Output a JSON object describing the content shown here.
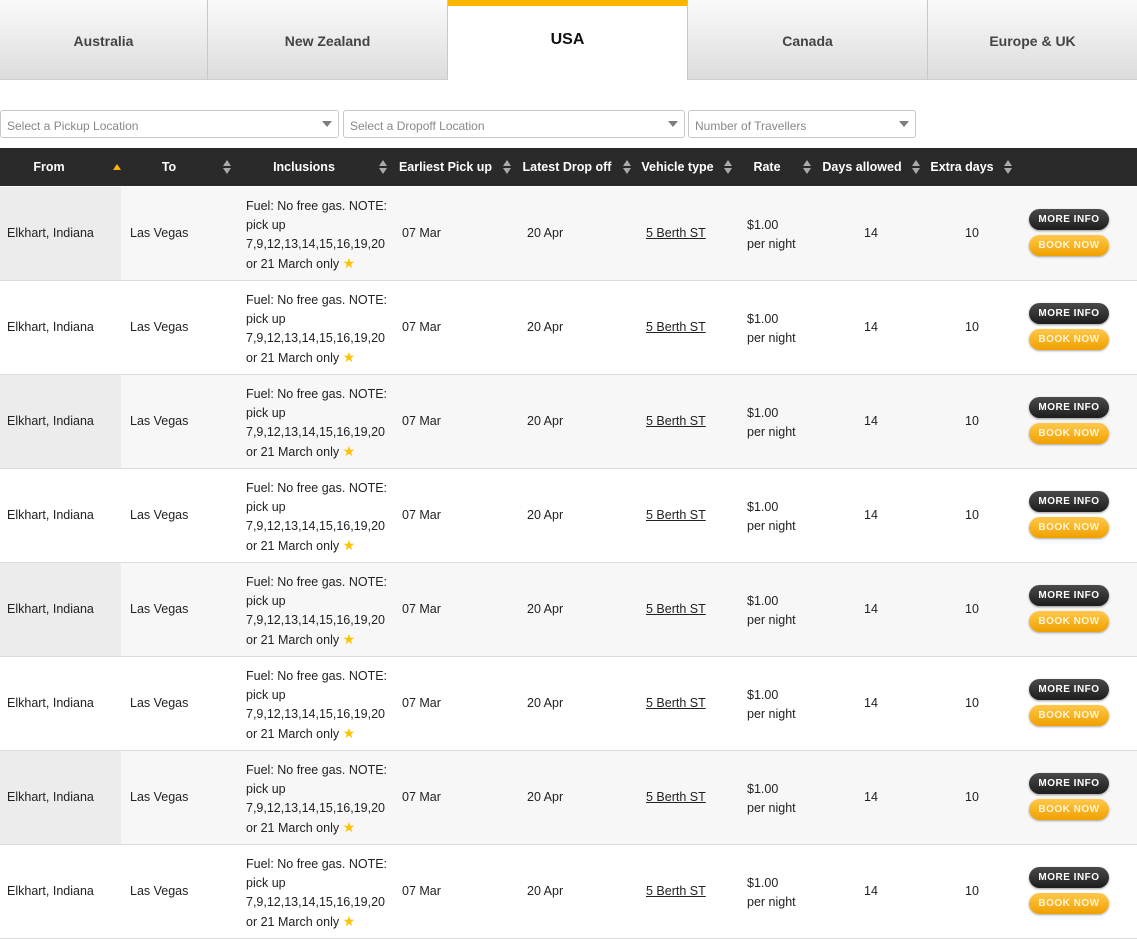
{
  "tabs": [
    {
      "label": "Australia",
      "active": false
    },
    {
      "label": "New Zealand",
      "active": false
    },
    {
      "label": "USA",
      "active": true
    },
    {
      "label": "Canada",
      "active": false
    },
    {
      "label": "Europe & UK",
      "active": false
    }
  ],
  "filters": {
    "pickup": "Select a Pickup Location",
    "dropoff": "Select a Dropoff Location",
    "travellers": "Number of Travellers"
  },
  "columns": {
    "from": "From",
    "to": "To",
    "inclusions": "Inclusions",
    "earliest": "Earliest Pick up",
    "latest": "Latest Drop off",
    "vehicle": "Vehicle type",
    "rate": "Rate",
    "days": "Days allowed",
    "extra": "Extra days"
  },
  "rows": [
    {
      "from": "Elkhart, Indiana",
      "to": "Las Vegas",
      "inclusions": "Fuel: No free gas. NOTE: pick up 7,9,12,13,14,15,16,19,20 or 21 March only",
      "earliest": "07 Mar",
      "latest": "20 Apr",
      "vehicle": "5 Berth ST",
      "rate": "$1.00",
      "rate_unit": "per night",
      "days": "14",
      "extra": "10",
      "more": "MORE INFO",
      "book": "BOOK NOW"
    },
    {
      "from": "Elkhart, Indiana",
      "to": "Las Vegas",
      "inclusions": "Fuel: No free gas. NOTE: pick up 7,9,12,13,14,15,16,19,20 or 21 March only",
      "earliest": "07 Mar",
      "latest": "20 Apr",
      "vehicle": "5 Berth ST",
      "rate": "$1.00",
      "rate_unit": "per night",
      "days": "14",
      "extra": "10",
      "more": "MORE INFO",
      "book": "BOOK NOW"
    },
    {
      "from": "Elkhart, Indiana",
      "to": "Las Vegas",
      "inclusions": "Fuel: No free gas. NOTE: pick up 7,9,12,13,14,15,16,19,20 or 21 March only",
      "earliest": "07 Mar",
      "latest": "20 Apr",
      "vehicle": "5 Berth ST",
      "rate": "$1.00",
      "rate_unit": "per night",
      "days": "14",
      "extra": "10",
      "more": "MORE INFO",
      "book": "BOOK NOW"
    },
    {
      "from": "Elkhart, Indiana",
      "to": "Las Vegas",
      "inclusions": "Fuel: No free gas. NOTE: pick up 7,9,12,13,14,15,16,19,20 or 21 March only",
      "earliest": "07 Mar",
      "latest": "20 Apr",
      "vehicle": "5 Berth ST",
      "rate": "$1.00",
      "rate_unit": "per night",
      "days": "14",
      "extra": "10",
      "more": "MORE INFO",
      "book": "BOOK NOW"
    },
    {
      "from": "Elkhart, Indiana",
      "to": "Las Vegas",
      "inclusions": "Fuel: No free gas. NOTE: pick up 7,9,12,13,14,15,16,19,20 or 21 March only",
      "earliest": "07 Mar",
      "latest": "20 Apr",
      "vehicle": "5 Berth ST",
      "rate": "$1.00",
      "rate_unit": "per night",
      "days": "14",
      "extra": "10",
      "more": "MORE INFO",
      "book": "BOOK NOW"
    },
    {
      "from": "Elkhart, Indiana",
      "to": "Las Vegas",
      "inclusions": "Fuel: No free gas. NOTE: pick up 7,9,12,13,14,15,16,19,20 or 21 March only",
      "earliest": "07 Mar",
      "latest": "20 Apr",
      "vehicle": "5 Berth ST",
      "rate": "$1.00",
      "rate_unit": "per night",
      "days": "14",
      "extra": "10",
      "more": "MORE INFO",
      "book": "BOOK NOW"
    },
    {
      "from": "Elkhart, Indiana",
      "to": "Las Vegas",
      "inclusions": "Fuel: No free gas. NOTE: pick up 7,9,12,13,14,15,16,19,20 or 21 March only",
      "earliest": "07 Mar",
      "latest": "20 Apr",
      "vehicle": "5 Berth ST",
      "rate": "$1.00",
      "rate_unit": "per night",
      "days": "14",
      "extra": "10",
      "more": "MORE INFO",
      "book": "BOOK NOW"
    },
    {
      "from": "Elkhart, Indiana",
      "to": "Las Vegas",
      "inclusions": "Fuel: No free gas. NOTE: pick up 7,9,12,13,14,15,16,19,20 or 21 March only",
      "earliest": "07 Mar",
      "latest": "20 Apr",
      "vehicle": "5 Berth ST",
      "rate": "$1.00",
      "rate_unit": "per night",
      "days": "14",
      "extra": "10",
      "more": "MORE INFO",
      "book": "BOOK NOW"
    }
  ],
  "colors": {
    "accent": "#ffb400",
    "header_bg": "#2a2a2a",
    "star": "#ffc200"
  },
  "icons": {
    "star": "star-icon",
    "sort": "sort-arrows-icon",
    "dropdown": "chevron-down-icon"
  }
}
